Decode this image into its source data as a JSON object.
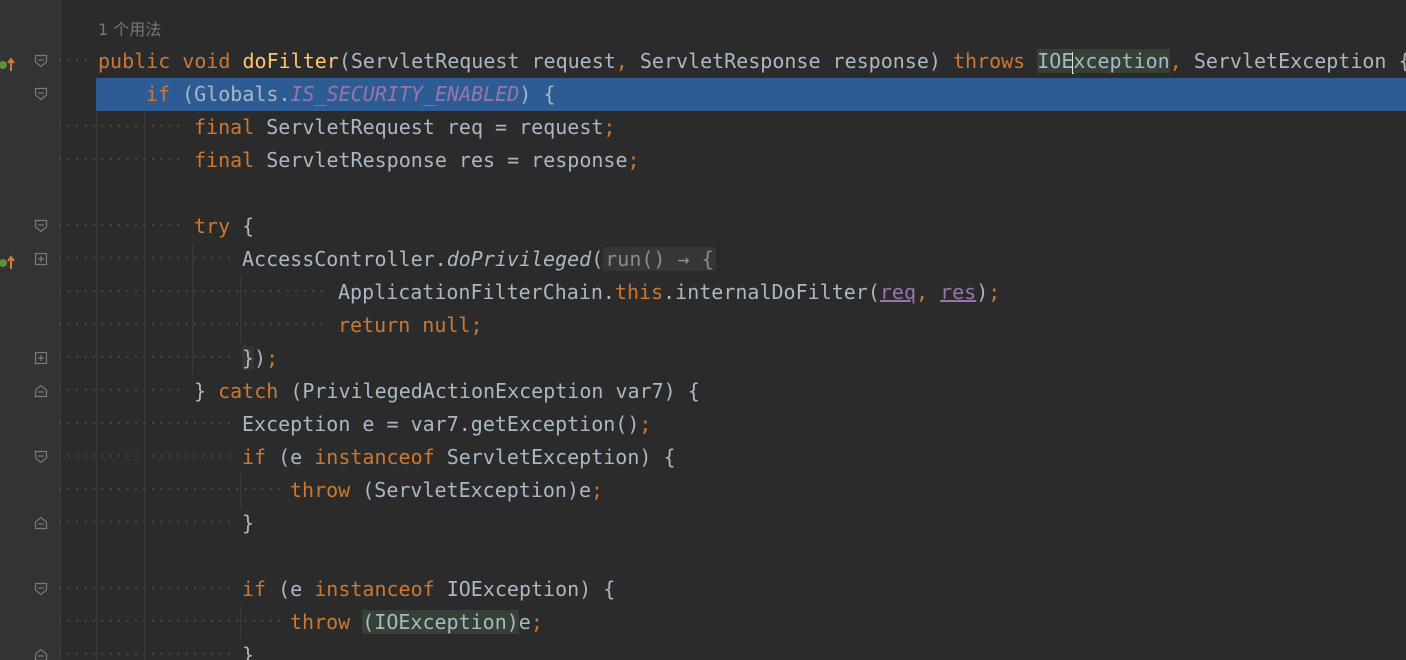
{
  "editor": {
    "usage_hint": "1 个用法",
    "colors": {
      "background": "#2b2b2b",
      "selection": "#2d5b93",
      "keyword": "#cc7832",
      "function": "#ffc66d",
      "static_field": "#9876aa",
      "text": "#a9b7c6"
    },
    "lines": [
      {
        "id": "sig",
        "tokens": [
          {
            "t": "public ",
            "c": "kw"
          },
          {
            "t": "void ",
            "c": "kw"
          },
          {
            "t": "doFilter",
            "c": "fn"
          },
          {
            "t": "(ServletRequest request",
            "c": ""
          },
          {
            "t": ", ",
            "c": "kw"
          },
          {
            "t": "ServletResponse response) ",
            "c": ""
          },
          {
            "t": "throws ",
            "c": "kw"
          },
          {
            "t": "IOE",
            "c": "hlbg"
          },
          {
            "t": "|caret|",
            "c": "caret"
          },
          {
            "t": "xception",
            "c": "hlbg"
          },
          {
            "t": ", ",
            "c": "kw"
          },
          {
            "t": "ServletException {",
            "c": ""
          }
        ]
      },
      {
        "id": "if-globals",
        "tokens": [
          {
            "t": "if ",
            "c": "kw"
          },
          {
            "t": "(Globals.",
            "c": ""
          },
          {
            "t": "IS_SECURITY_ENABLED",
            "c": "static"
          },
          {
            "t": ") {",
            "c": ""
          }
        ]
      },
      {
        "id": "final-req",
        "tokens": [
          {
            "t": "final ",
            "c": "kw"
          },
          {
            "t": "ServletRequest req = request",
            "c": ""
          },
          {
            "t": ";",
            "c": "kw"
          }
        ]
      },
      {
        "id": "final-res",
        "tokens": [
          {
            "t": "final ",
            "c": "kw"
          },
          {
            "t": "ServletResponse res = response",
            "c": ""
          },
          {
            "t": ";",
            "c": "kw"
          }
        ]
      },
      {
        "id": "blank-1",
        "tokens": []
      },
      {
        "id": "try",
        "tokens": [
          {
            "t": "try ",
            "c": "kw"
          },
          {
            "t": "{",
            "c": ""
          }
        ]
      },
      {
        "id": "access-controller",
        "tokens": [
          {
            "t": "AccessController.",
            "c": ""
          },
          {
            "t": "doPrivileged",
            "c": "it"
          },
          {
            "t": "(",
            "c": ""
          },
          {
            "t": "run() → {",
            "c": "hint"
          }
        ]
      },
      {
        "id": "internal-do-filter",
        "tokens": [
          {
            "t": "ApplicationFilterChain.",
            "c": ""
          },
          {
            "t": "this",
            "c": "kw"
          },
          {
            "t": ".internalDoFilter(",
            "c": ""
          },
          {
            "t": "req",
            "c": "uvar"
          },
          {
            "t": ", ",
            "c": "kw"
          },
          {
            "t": "res",
            "c": "uvar"
          },
          {
            "t": ")",
            "c": ""
          },
          {
            "t": ";",
            "c": "kw"
          }
        ]
      },
      {
        "id": "return-null",
        "tokens": [
          {
            "t": "return null",
            "c": "kw"
          },
          {
            "t": ";",
            "c": "kw"
          }
        ]
      },
      {
        "id": "close-lambda",
        "tokens": [
          {
            "t": "}",
            "c": "lam"
          },
          {
            "t": ")",
            "c": ""
          },
          {
            "t": ";",
            "c": "kw"
          }
        ]
      },
      {
        "id": "catch",
        "tokens": [
          {
            "t": "} ",
            "c": ""
          },
          {
            "t": "catch ",
            "c": "kw"
          },
          {
            "t": "(PrivilegedActionException var7) {",
            "c": ""
          }
        ]
      },
      {
        "id": "exception-e",
        "tokens": [
          {
            "t": "Exception e = var7.getException()",
            "c": ""
          },
          {
            "t": ";",
            "c": "kw"
          }
        ]
      },
      {
        "id": "if-servlet-exception",
        "tokens": [
          {
            "t": "if ",
            "c": "kw"
          },
          {
            "t": "(e ",
            "c": ""
          },
          {
            "t": "instanceof ",
            "c": "kw"
          },
          {
            "t": "ServletException) {",
            "c": ""
          }
        ]
      },
      {
        "id": "throw-servlet",
        "tokens": [
          {
            "t": "throw ",
            "c": "kw"
          },
          {
            "t": "(ServletException)e",
            "c": ""
          },
          {
            "t": ";",
            "c": "kw"
          }
        ]
      },
      {
        "id": "close-if-1",
        "tokens": [
          {
            "t": "}",
            "c": ""
          }
        ]
      },
      {
        "id": "blank-2",
        "tokens": []
      },
      {
        "id": "if-io-exception",
        "tokens": [
          {
            "t": "if ",
            "c": "kw"
          },
          {
            "t": "(e ",
            "c": ""
          },
          {
            "t": "instanceof ",
            "c": "kw"
          },
          {
            "t": "IOException) {",
            "c": ""
          }
        ]
      },
      {
        "id": "throw-io",
        "tokens": [
          {
            "t": "throw ",
            "c": "kw"
          },
          {
            "t": "(IOException)",
            "c": "hlbg"
          },
          {
            "t": "e",
            "c": ""
          },
          {
            "t": ";",
            "c": "kw"
          }
        ]
      },
      {
        "id": "close-if-2",
        "tokens": [
          {
            "t": "}",
            "c": ""
          }
        ]
      }
    ]
  }
}
